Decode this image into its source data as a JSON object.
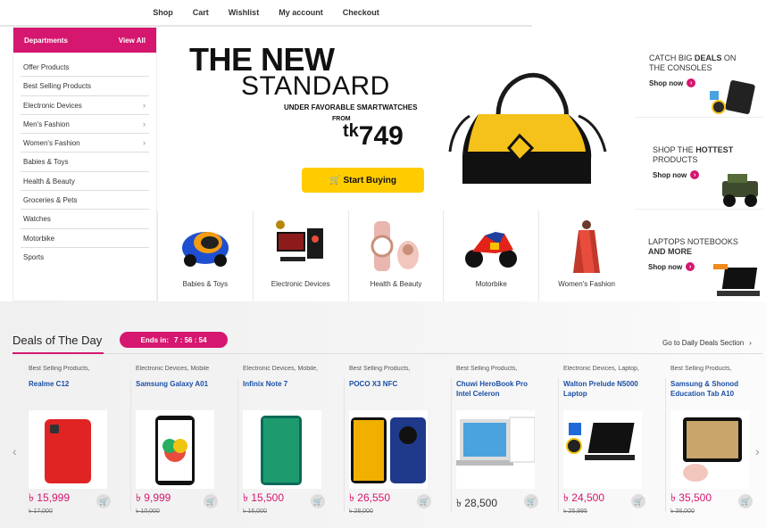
{
  "nav": [
    "Shop",
    "Cart",
    "Wishlist",
    "My account",
    "Checkout"
  ],
  "departments": {
    "title": "Departments",
    "view_all": "View All",
    "items": [
      {
        "label": "Offer Products",
        "sub": false
      },
      {
        "label": "Best Selling Products",
        "sub": false
      },
      {
        "label": "Electronic Devices",
        "sub": true
      },
      {
        "label": "Men's Fashion",
        "sub": true
      },
      {
        "label": "Women's Fashion",
        "sub": true
      },
      {
        "label": "Babies & Toys",
        "sub": false
      },
      {
        "label": "Health & Beauty",
        "sub": false
      },
      {
        "label": "Groceries & Pets",
        "sub": false
      },
      {
        "label": "Watches",
        "sub": false
      },
      {
        "label": "Motorbike",
        "sub": false
      },
      {
        "label": "Sports",
        "sub": false
      }
    ]
  },
  "hero": {
    "title1": "THE NEW",
    "title2": "STANDARD",
    "subtitle": "UNDER FAVORABLE SMARTWATCHES",
    "from": "FROM",
    "currency": "tk",
    "price": "749",
    "button": "Start Buying"
  },
  "promos": [
    {
      "line1": "CATCH BIG ",
      "bold": "DEALS",
      "line1b": " ON",
      "line2": "THE CONSOLES",
      "shop": "Shop now"
    },
    {
      "line1": "SHOP THE ",
      "bold": "HOTTEST",
      "line1b": "",
      "line2": "PRODUCTS",
      "shop": "Shop now"
    },
    {
      "line1": "LAPTOPS NOTEBOOKS",
      "bold": "AND MORE",
      "line1b": "",
      "line2": "",
      "shop": "Shop now"
    }
  ],
  "categories": [
    "Babies & Toys",
    "Electronic Devices",
    "Health & Beauty",
    "Motorbike",
    "Women's Fashion"
  ],
  "deals": {
    "title": "Deals of The Day",
    "ends_label": "Ends in:",
    "ends_time": "7 : 56 : 54",
    "goto": "Go to Daily Deals Section"
  },
  "products": [
    {
      "cat": "Best Selling Products,",
      "name": "Realme C12",
      "price": "৳ 15,999",
      "old": "৳ 17,000",
      "sale": true
    },
    {
      "cat": "Electronic Devices, Mobile",
      "name": "Samsung Galaxy A01",
      "price": "৳ 9,999",
      "old": "৳ 10,000",
      "sale": true
    },
    {
      "cat": "Electronic Devices, Mobile,",
      "name": "Infinix Note 7",
      "price": "৳ 15,500",
      "old": "৳ 16,000",
      "sale": true
    },
    {
      "cat": "Best Selling Products,",
      "name": "POCO X3 NFC",
      "price": "৳ 26,550",
      "old": "৳ 28,000",
      "sale": true
    },
    {
      "cat": "Best Selling Products,",
      "name": "Chuwi HeroBook Pro Intel Celeron",
      "price": "৳ 28,500",
      "old": "",
      "sale": false
    },
    {
      "cat": "Electronic Devices, Laptop,",
      "name": "Walton Prelude N5000 Laptop",
      "price": "৳ 24,500",
      "old": "৳ 25,995",
      "sale": true
    },
    {
      "cat": "Best Selling Products,",
      "name": "Samsung & Shonod Education Tab A10",
      "price": "৳ 35,500",
      "old": "৳ 38,000",
      "sale": true
    }
  ],
  "colors": {
    "accent": "#d5176f",
    "button": "#ffcc00",
    "link": "#1b4fa5"
  }
}
